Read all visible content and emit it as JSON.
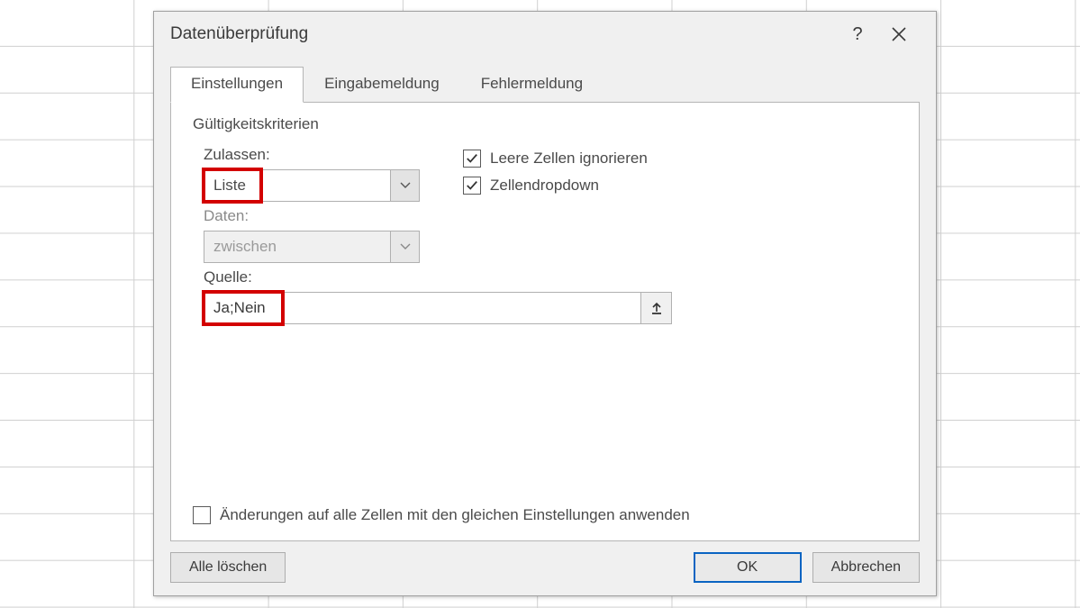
{
  "dialog": {
    "title": "Datenüberprüfung",
    "help_symbol": "?",
    "tabs": [
      {
        "label": "Einstellungen",
        "active": true
      },
      {
        "label": "Eingabemeldung",
        "active": false
      },
      {
        "label": "Fehlermeldung",
        "active": false
      }
    ],
    "section_heading": "Gültigkeitskriterien",
    "allow_label": "Zulassen:",
    "allow_value": "Liste",
    "data_label": "Daten:",
    "data_value": "zwischen",
    "checkbox_ignore_blank": {
      "label": "Leere Zellen ignorieren",
      "checked": true
    },
    "checkbox_dropdown": {
      "label": "Zellendropdown",
      "checked": true
    },
    "source_label": "Quelle:",
    "source_value": "Ja;Nein",
    "apply_all_label": "Änderungen auf alle Zellen mit den gleichen Einstellungen anwenden",
    "apply_all_checked": false,
    "buttons": {
      "clear_all": "Alle löschen",
      "ok": "OK",
      "cancel": "Abbrechen"
    }
  }
}
